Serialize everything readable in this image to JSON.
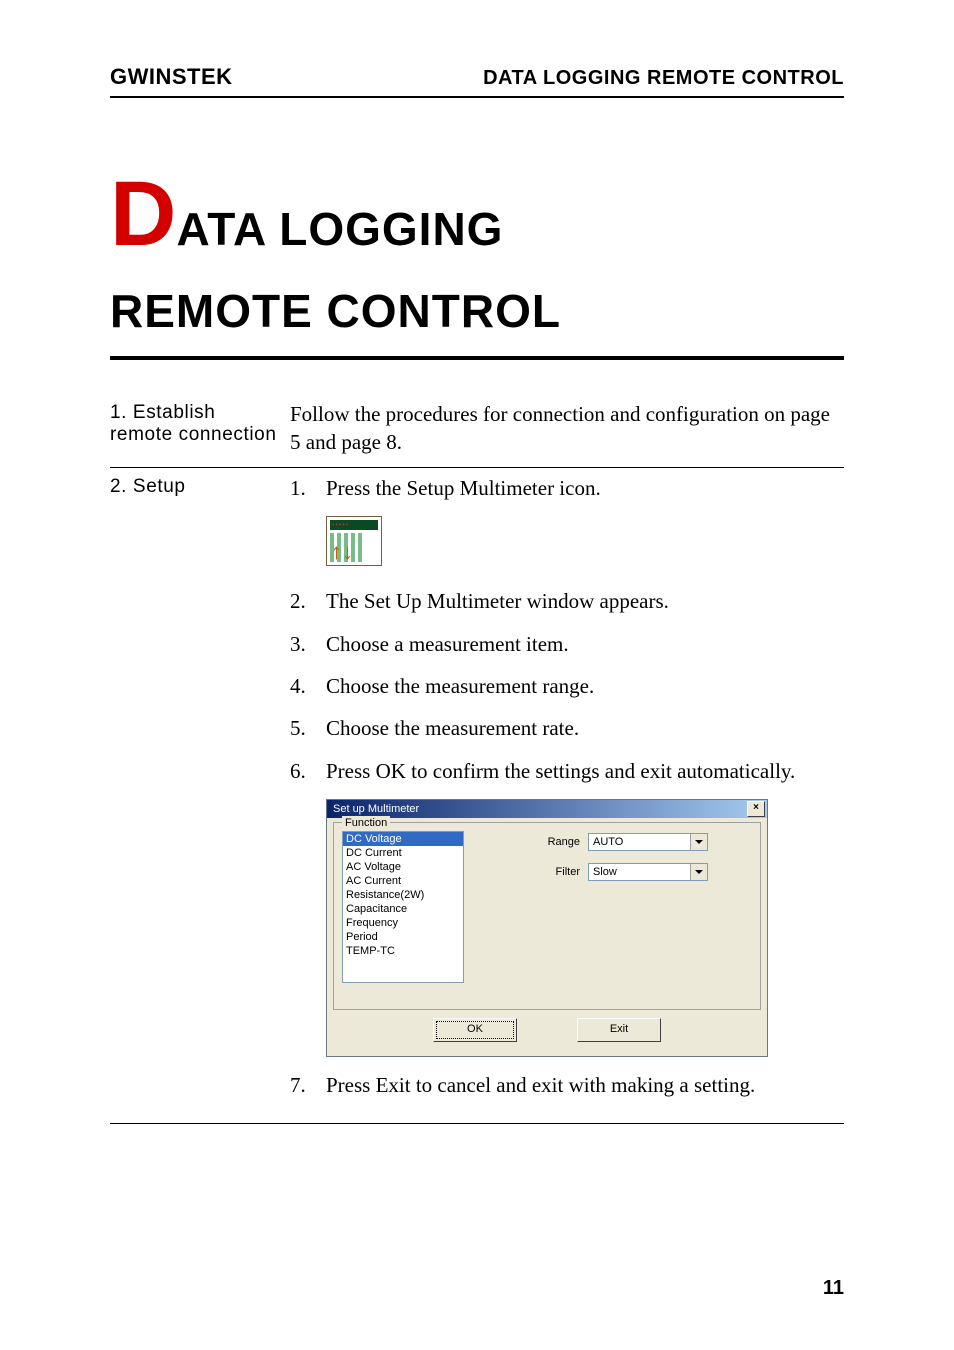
{
  "header": {
    "logo": "GWINSTEK",
    "title": "DATA LOGGING REMOTE CONTROL"
  },
  "main_title": {
    "dropcap": "D",
    "rest1": "ATA LOGGING",
    "line2": "REMOTE CONTROL"
  },
  "section1": {
    "heading": "1. Establish remote connection",
    "text": "Follow the procedures for connection and configuration on page 5 and page 8."
  },
  "section2": {
    "heading": "2. Setup",
    "steps": [
      {
        "num": "1.",
        "text": "Press the Setup Multimeter icon."
      },
      {
        "num": "2.",
        "text": "The Set Up Multimeter window appears."
      },
      {
        "num": "3.",
        "text": "Choose a measurement item."
      },
      {
        "num": "4.",
        "text": "Choose the measurement range."
      },
      {
        "num": "5.",
        "text": "Choose the measurement rate."
      },
      {
        "num": "6.",
        "text": "Press OK to confirm the settings and exit automatically."
      },
      {
        "num": "7.",
        "text": "Press Exit to cancel and exit with making a setting."
      }
    ]
  },
  "icon": {
    "arrows": "↑↓",
    "dots": "•••••"
  },
  "dialog": {
    "title": "Set up Multimeter",
    "close": "×",
    "group_label": "Function",
    "functions": [
      "DC Voltage",
      "DC Current",
      "AC Voltage",
      "AC Current",
      "Resistance(2W)",
      "Capacitance",
      "Frequency",
      "Period",
      "TEMP-TC"
    ],
    "selected_function_index": 0,
    "range_label": "Range",
    "range_value": "AUTO",
    "filter_label": "Filter",
    "filter_value": "Slow",
    "ok": "OK",
    "exit": "Exit"
  },
  "page_number": "11"
}
